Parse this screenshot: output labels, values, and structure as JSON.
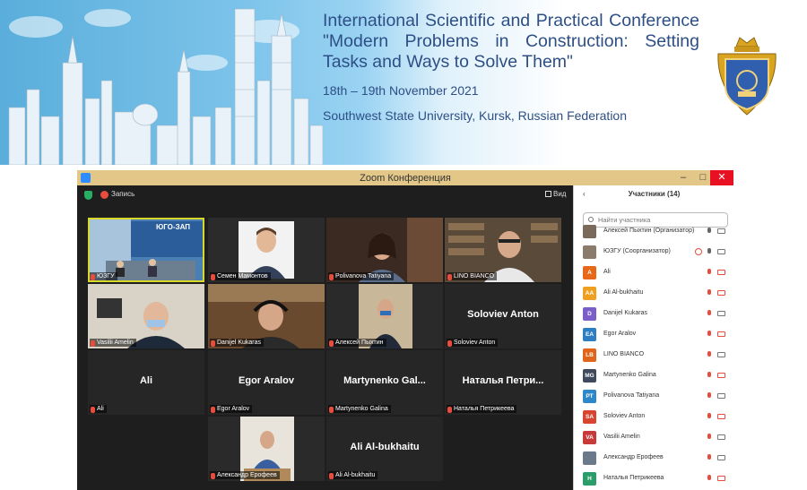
{
  "banner": {
    "title": "International Scientific and Practical Conference \"Modern Problems in Construction: Setting Tasks and Ways to Solve Them\"",
    "dates": "18th – 19th November 2021",
    "venue": "Southwest State University, Kursk, Russian Federation"
  },
  "window": {
    "title": "Zoom Конференция",
    "minimize": "–",
    "maximize": "□",
    "close": "✕"
  },
  "toolbar": {
    "record_label": "Запись",
    "view_label": "Вид"
  },
  "active_tile_overlay": "ЮГО-ЗАП",
  "tiles": [
    {
      "name": "ЮЗГУ",
      "big": ""
    },
    {
      "name": "Семен Мамонтов",
      "big": ""
    },
    {
      "name": "Polivanova Tatiyana",
      "big": ""
    },
    {
      "name": "LINO BIANCO",
      "big": ""
    },
    {
      "name": "Vasilii Amelin",
      "big": ""
    },
    {
      "name": "Danijel Kukaras",
      "big": ""
    },
    {
      "name": "Алексей Пыхтин",
      "big": ""
    },
    {
      "name": "Soloviev Anton",
      "big": "Soloviev Anton"
    },
    {
      "name": "Ali",
      "big": "Ali"
    },
    {
      "name": "Egor Aralov",
      "big": "Egor Aralov"
    },
    {
      "name": "Martynenko Galina",
      "big": "Martynenko Gal..."
    },
    {
      "name": "Наталья Петрикеева",
      "big": "Наталья Петри..."
    },
    {
      "name": "Александр Ерофеев",
      "big": ""
    },
    {
      "name": "Ali Al-bukhaitu",
      "big": "Ali Al-bukhaitu"
    }
  ],
  "panel": {
    "title": "Участники (14)",
    "collapse": "‹",
    "search_placeholder": "Найти участника",
    "participants": [
      {
        "initials": "",
        "name": "Алексей Пыхтин (Организатор)",
        "color": "#7a6a5a",
        "mic_on": true,
        "cam_on": true
      },
      {
        "initials": "",
        "name": "ЮЗГУ (Соорганизатор)",
        "color": "#8b7b6b",
        "mic_on": true,
        "cam_on": true
      },
      {
        "initials": "A",
        "name": "Ali",
        "color": "#e8681a",
        "mic_on": false,
        "cam_on": false
      },
      {
        "initials": "AA",
        "name": "Ali Al-bukhaitu",
        "color": "#f0a020",
        "mic_on": false,
        "cam_on": false
      },
      {
        "initials": "D",
        "name": "Danijel Kukaras",
        "color": "#7b5fc9",
        "mic_on": false,
        "cam_on": true
      },
      {
        "initials": "EA",
        "name": "Egor Aralov",
        "color": "#2d7fc1",
        "mic_on": false,
        "cam_on": false
      },
      {
        "initials": "LB",
        "name": "LINO BIANCO",
        "color": "#e0651a",
        "mic_on": false,
        "cam_on": true
      },
      {
        "initials": "MG",
        "name": "Martynenko Galina",
        "color": "#3f4a5c",
        "mic_on": false,
        "cam_on": false
      },
      {
        "initials": "PT",
        "name": "Polivanova Tatiyana",
        "color": "#2d87c8",
        "mic_on": false,
        "cam_on": true
      },
      {
        "initials": "SA",
        "name": "Soloviev Anton",
        "color": "#d8452f",
        "mic_on": false,
        "cam_on": false
      },
      {
        "initials": "VA",
        "name": "Vasilii Amelin",
        "color": "#c83a3a",
        "mic_on": false,
        "cam_on": true
      },
      {
        "initials": "",
        "name": "Александр Ерофеев",
        "color": "#6a7a8a",
        "mic_on": false,
        "cam_on": true
      },
      {
        "initials": "Н",
        "name": "Наталья Петрикеева",
        "color": "#2a9d6a",
        "mic_on": false,
        "cam_on": false
      }
    ]
  }
}
